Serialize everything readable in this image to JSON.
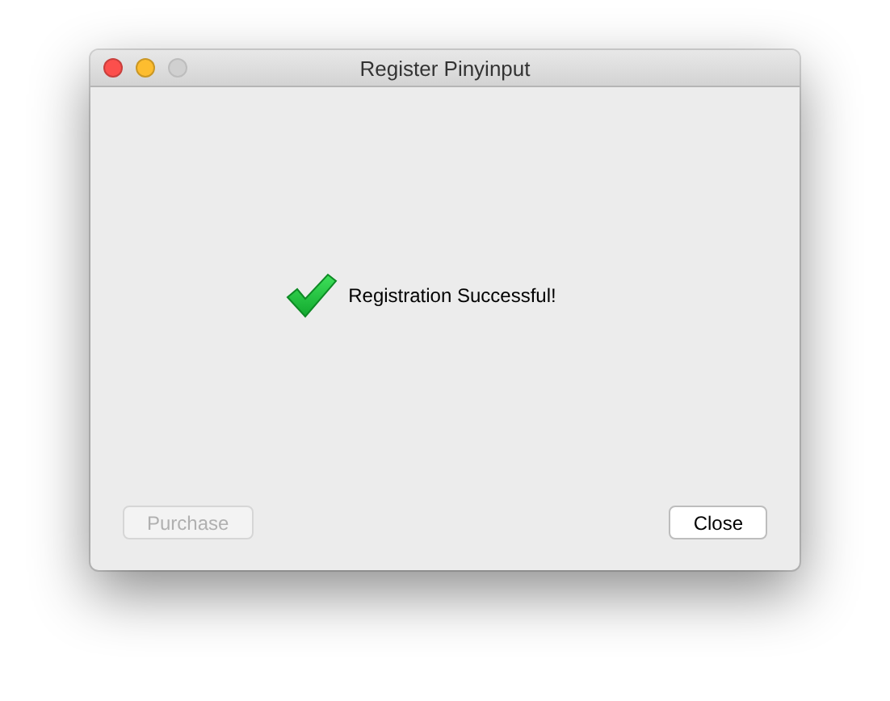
{
  "window": {
    "title": "Register Pinyinput",
    "controls": [
      {
        "kind": "close",
        "disabled": false
      },
      {
        "kind": "minimize",
        "disabled": false
      },
      {
        "kind": "zoom",
        "disabled": true
      }
    ]
  },
  "message": "Registration Successful!",
  "buttons": [
    {
      "label": "Purchase",
      "disabled": true
    },
    {
      "label": "Close",
      "disabled": false
    }
  ]
}
